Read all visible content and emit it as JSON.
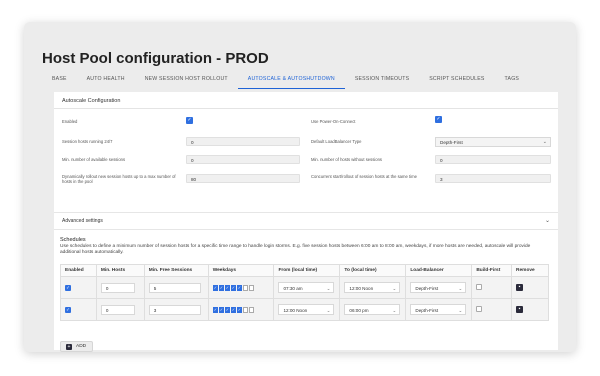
{
  "page": {
    "title": "Host Pool configuration - PROD"
  },
  "tabs": [
    {
      "label": "BASE"
    },
    {
      "label": "AUTO HEALTH"
    },
    {
      "label": "NEW SESSION HOST ROLLOUT"
    },
    {
      "label": "AUTOSCALE & AUTOSHUTDOWN",
      "active": true
    },
    {
      "label": "SESSION TIMEOUTS"
    },
    {
      "label": "SCRIPT SCHEDULES"
    },
    {
      "label": "TAGS"
    }
  ],
  "autoscale": {
    "section_title": "Autoscale Configuration",
    "enabled_label": "Enabled",
    "enabled": true,
    "use_power_on_label": "Use Power-On-Connect",
    "use_power_on": true,
    "running_24_7_label": "Session hosts running 24/7",
    "running_24_7_value": "0",
    "default_lb_label": "Default LoadBalancer Type",
    "default_lb_value": "Depth-First",
    "min_available_label": "Min. number of available sessions",
    "min_available_value": "0",
    "min_without_sessions_label": "Min. number of hosts without sessions",
    "min_without_sessions_value": "0",
    "dynamic_rollout_label": "Dynamically rollout new session hosts up to a max number of hosts in the pool",
    "dynamic_rollout_value": "80",
    "concurrent_label": "Concurrent start/rollout of session hosts at the same time",
    "concurrent_value": "3"
  },
  "advanced": {
    "label": "Advanced settings"
  },
  "schedules": {
    "title": "Schedules",
    "description": "Use schedules to define a minimum number of session hosts for a specific time range to handle login storms. E.g. five session hosts between 6:00 am to 8:00 am, weekdays, if more hosts are needed, autoscale will provide additional hosts automatically.",
    "columns": [
      "Enabled",
      "Min. Hosts",
      "Min. Free Sessions",
      "Weekdays",
      "From (local time)",
      "To (local time)",
      "Load-Balancer",
      "Build-First",
      "Remove"
    ],
    "rows": [
      {
        "enabled": true,
        "min_hosts": "0",
        "min_free": "5",
        "weekdays": [
          true,
          true,
          true,
          true,
          true,
          false,
          false
        ],
        "from": "07:30 am",
        "to": "12:00 Noon",
        "lb": "Depth-First",
        "build_first": false
      },
      {
        "enabled": true,
        "min_hosts": "0",
        "min_free": "3",
        "weekdays": [
          true,
          true,
          true,
          true,
          true,
          false,
          false
        ],
        "from": "12:00 Noon",
        "to": "06:00 pm",
        "lb": "Depth-First",
        "build_first": false
      }
    ],
    "add_label": "ADD"
  },
  "icons": {
    "check": "check-icon",
    "chevron": "chevron-down-icon",
    "plus": "plus-icon",
    "remove": "remove-icon"
  },
  "colors": {
    "accent": "#2f6fe0"
  }
}
